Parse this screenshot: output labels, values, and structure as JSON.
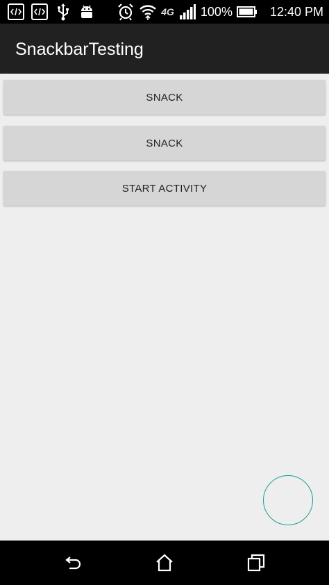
{
  "status_bar": {
    "left_icons": [
      "code-icon",
      "code-icon",
      "usb-icon",
      "android-icon"
    ],
    "right_icons": [
      "alarm-clock-icon",
      "wifi-icon",
      "lte-icon",
      "signal-icon",
      "battery-icon"
    ],
    "network_label": "4G",
    "battery_percent": "100%",
    "time": "12:40 PM"
  },
  "toolbar": {
    "title": "SnackbarTesting",
    "background": "#212121"
  },
  "buttons": [
    {
      "label": "SNACK"
    },
    {
      "label": "SNACK"
    },
    {
      "label": "START ACTIVITY"
    }
  ],
  "fab": {
    "border_color": "#1a9e93"
  },
  "nav_bar": {
    "icons": [
      "back-icon",
      "home-icon",
      "recent-apps-icon"
    ]
  }
}
